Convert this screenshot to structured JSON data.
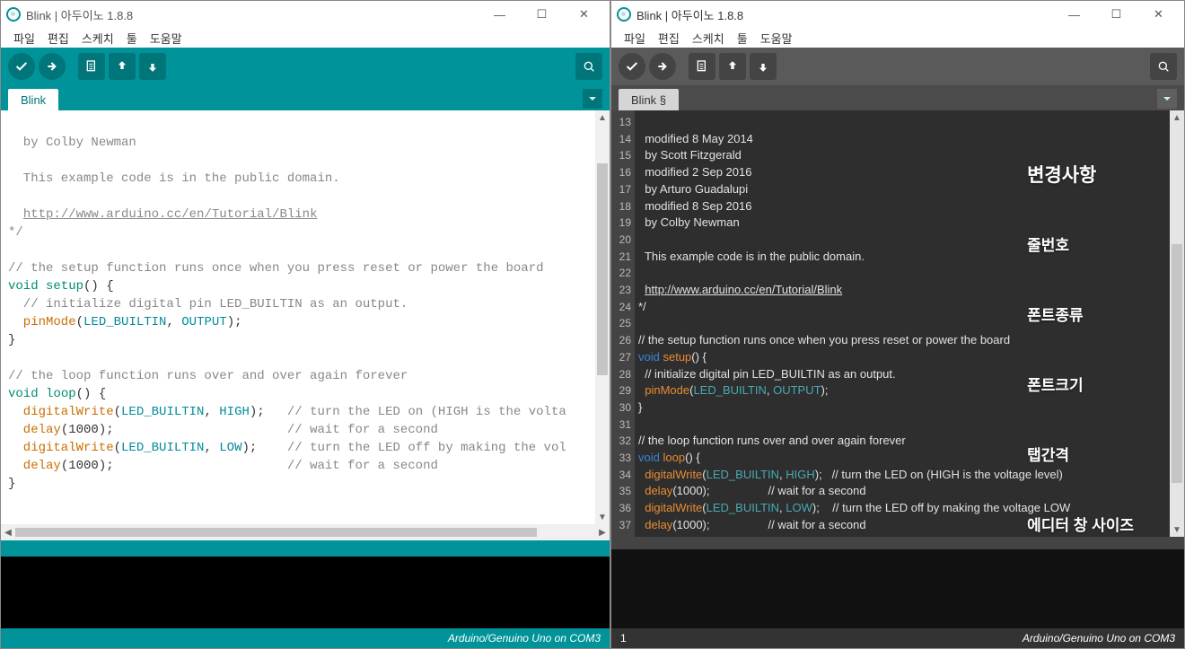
{
  "left": {
    "title": "Blink | 아두이노 1.8.8",
    "menu": [
      "파일",
      "편집",
      "스케치",
      "툴",
      "도움말"
    ],
    "tab": "Blink",
    "code": {
      "author": "  by Colby Newman",
      "blank1": "",
      "pubdomain": "  This example code is in the public domain.",
      "blank2": "",
      "url_pre": "  ",
      "url": "http://www.arduino.cc/en/Tutorial/Blink",
      "endcom": "*/",
      "blank3": "",
      "setup_cm": "// the setup function runs once when you press reset or power the board",
      "setup_kw": "void",
      "setup_fn": " setup",
      "setup_pr": "() {",
      "init_cm": "  // initialize digital pin LED_BUILTIN as an output.",
      "pm1": "  pinMode",
      "pm2": "(",
      "pm3": "LED_BUILTIN",
      "pm4": ", ",
      "pm5": "OUTPUT",
      "pm6": ");",
      "brace1": "}",
      "blank4": "",
      "loop_cm": "// the loop function runs over and over again forever",
      "loop_kw": "void",
      "loop_fn": " loop",
      "loop_pr": "() {",
      "dw1a": "  digitalWrite",
      "dw1b": "(",
      "dw1c": "LED_BUILTIN",
      "dw1d": ", ",
      "dw1e": "HIGH",
      "dw1f": ");   ",
      "dw1g": "// turn the LED on (HIGH is the volta",
      "dl1a": "  delay",
      "dl1b": "(1000);                       ",
      "dl1c": "// wait for a second",
      "dw2a": "  digitalWrite",
      "dw2b": "(",
      "dw2c": "LED_BUILTIN",
      "dw2d": ", ",
      "dw2e": "LOW",
      "dw2f": ");    ",
      "dw2g": "// turn the LED off by making the vol",
      "dl2a": "  delay",
      "dl2b": "(1000);                       ",
      "dl2c": "// wait for a second",
      "brace2": "}"
    },
    "status": "Arduino/Genuino Uno on COM3"
  },
  "right": {
    "title": "Blink | 아두이노 1.8.8",
    "menu": [
      "파일",
      "편집",
      "스케치",
      "툴",
      "도움말"
    ],
    "tab": "Blink §",
    "lines_start": 13,
    "lines_end": 37,
    "code": {
      "l13": "  modified 8 May 2014",
      "l14": "  by Scott Fitzgerald",
      "l15": "  modified 2 Sep 2016",
      "l16": "  by Arturo Guadalupi",
      "l17": "  modified 8 Sep 2016",
      "l18": "  by Colby Newman",
      "l19": "",
      "l20": "  This example code is in the public domain.",
      "l21": "",
      "l22_pre": "  ",
      "l22_url": "http://www.arduino.cc/en/Tutorial/Blink",
      "l23": "*/",
      "l24": "",
      "l25": "// the setup function runs once when you press reset or power the board",
      "l26_kw": "void",
      "l26_fn": " setup",
      "l26_tail": "() {",
      "l27": "  // initialize digital pin LED_BUILTIN as an output.",
      "l28_a": "  pinMode",
      "l28_b": "(",
      "l28_c": "LED_BUILTIN",
      "l28_d": ", ",
      "l28_e": "OUTPUT",
      "l28_f": ");",
      "l29": "}",
      "l30": "",
      "l31": "// the loop function runs over and over again forever",
      "l32_kw": "void",
      "l32_fn": " loop",
      "l32_tail": "() {",
      "l33_a": "  digitalWrite",
      "l33_b": "(",
      "l33_c": "LED_BUILTIN",
      "l33_d": ", ",
      "l33_e": "HIGH",
      "l33_f": ");   ",
      "l33_g": "// turn the LED on (HIGH is the voltage level)",
      "l34_a": "  delay",
      "l34_b": "(1000);                  ",
      "l34_c": "// wait for a second",
      "l35_a": "  digitalWrite",
      "l35_b": "(",
      "l35_c": "LED_BUILTIN",
      "l35_d": ", ",
      "l35_e": "LOW",
      "l35_f": ");    ",
      "l35_g": "// turn the LED off by making the voltage LOW",
      "l36_a": "  delay",
      "l36_b": "(1000);                  ",
      "l36_c": "// wait for a second",
      "l37": "}"
    },
    "overlay": {
      "title": "변경사항",
      "items": [
        "줄번호",
        "폰트종류",
        "폰트크기",
        "탭간격",
        "에디터 창 사이즈"
      ]
    },
    "status_left": "1",
    "status": "Arduino/Genuino Uno on COM3"
  }
}
